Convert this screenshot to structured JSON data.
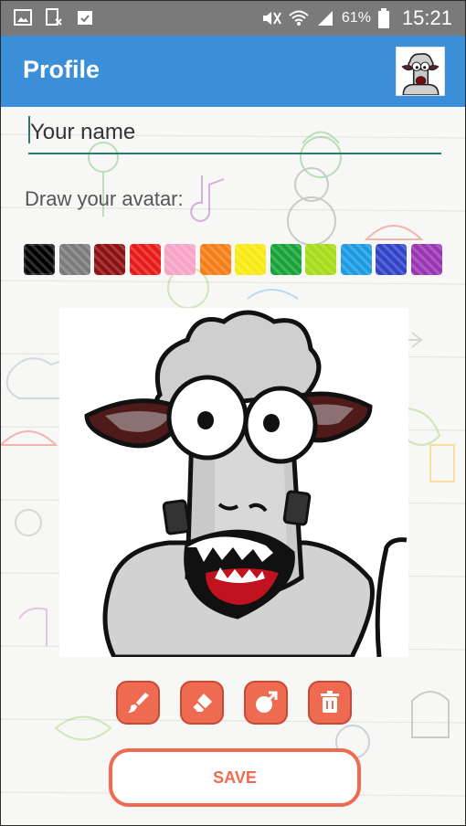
{
  "status_bar": {
    "battery": "61%",
    "time": "15:21"
  },
  "app_bar": {
    "title": "Profile"
  },
  "form": {
    "name_placeholder": "Your name",
    "name_value": "",
    "draw_label": "Draw your avatar:"
  },
  "palette": {
    "colors": [
      "#000000",
      "#7b7b7b",
      "#8e1010",
      "#e81a1a",
      "#f6a3c7",
      "#f77e17",
      "#f8ea11",
      "#18a339",
      "#a6dc16",
      "#1b9be2",
      "#3144c8",
      "#9a36b4"
    ],
    "selected_index": 0
  },
  "tools": [
    "brush-icon",
    "eraser-icon",
    "image-import-icon",
    "trash-icon"
  ],
  "save_label": "SAVE",
  "colors": {
    "primary": "#3b8fd9",
    "accent": "#ee6a50",
    "input_line": "#2a7a74"
  }
}
